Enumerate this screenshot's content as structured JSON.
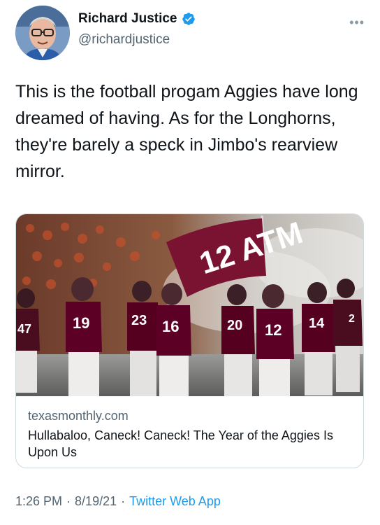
{
  "author": {
    "name": "Richard Justice",
    "handle": "@richardjustice"
  },
  "tweet": {
    "text": "This is the football progam Aggies have long dreamed of having. As for the Longhorns, they're barely a speck in Jimbo's rearview mirror."
  },
  "card": {
    "domain": "texasmonthly.com",
    "title": "Hullabaloo, Caneck! Caneck! The Year of the Aggies Is Upon Us",
    "flag_text": "12 ATM",
    "jersey_numbers": [
      "47",
      "19",
      "23",
      "16",
      "20",
      "12",
      "14",
      "2"
    ]
  },
  "meta": {
    "time": "1:26 PM",
    "separator": "·",
    "date": "8/19/21",
    "app": "Twitter Web App"
  },
  "colors": {
    "accent": "#1d9bf0",
    "maroon": "#5c0025",
    "secondary_text": "#536471"
  },
  "icons": {
    "verified": "verified-badge-icon",
    "more": "more-options-icon"
  }
}
